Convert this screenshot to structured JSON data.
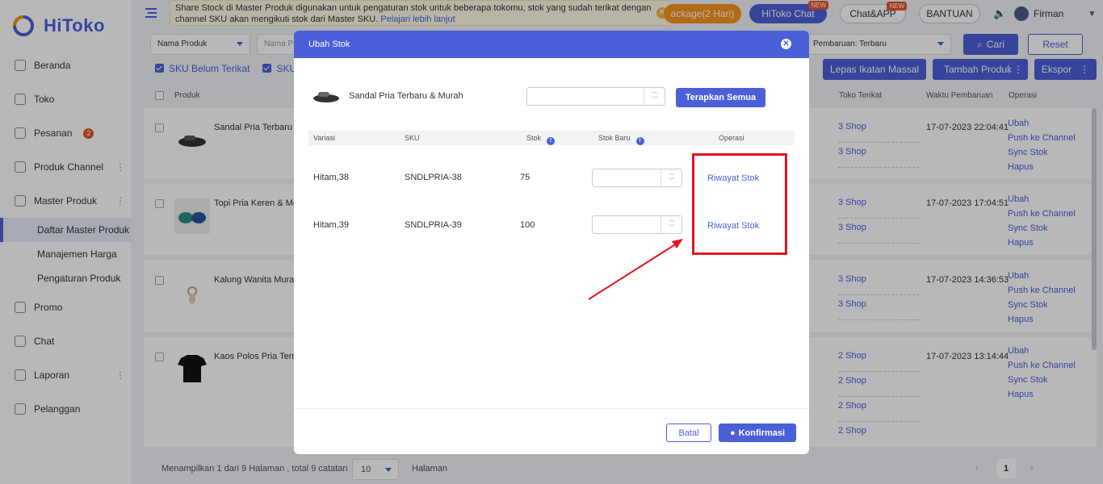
{
  "app": {
    "name": "HiToko"
  },
  "sidebar": {
    "items": [
      {
        "label": "Beranda"
      },
      {
        "label": "Toko"
      },
      {
        "label": "Pesanan",
        "badge": "2"
      },
      {
        "label": "Produk Channel"
      },
      {
        "label": "Master Produk"
      }
    ],
    "sub_items": [
      {
        "label": "Daftar Master Produk"
      },
      {
        "label": "Manajemen Harga"
      },
      {
        "label": "Pengaturan Produk"
      }
    ],
    "items_after": [
      {
        "label": "Promo"
      },
      {
        "label": "Chat"
      },
      {
        "label": "Laporan"
      },
      {
        "label": "Pelanggan"
      }
    ]
  },
  "topbar": {
    "notice": "Share Stock di Master Produk digunakan untuk pengaturan stok untuk beberapa tokomu, stok yang sudah terikat dengan channel SKU akan mengikuti stok dari Master SKU.",
    "notice_link": "Pelajari lebih lanjut",
    "package_label": "ackage(2 Hari)",
    "chat_label": "HiToko Chat",
    "chatapp_label": "Chat&APP",
    "new_tag": "NEW",
    "bantuan_label": "BANTUAN",
    "user_name": "Firman"
  },
  "filters": {
    "field_select": "Nama Produk",
    "field_input_placeholder": "Nama Pr",
    "sort_select": "Pembaruan: Terbaru",
    "search_label": "Cari",
    "reset_label": "Reset"
  },
  "checkbox_filters": [
    "SKU Belum Terikat",
    "SKU"
  ],
  "actions": {
    "lepas_label": "Lepas Ikatan Massal",
    "tambah_label": "Tambah Produk",
    "ekspor_label": "Ekspor"
  },
  "table": {
    "headers": {
      "produk": "Produk",
      "toko": "Toko Terikat",
      "waktu": "Waktu Pembaruan",
      "operasi": "Operasi"
    },
    "rows": [
      {
        "name": "Sandal Pria Terbaru &",
        "shops": [
          "3 Shop",
          "3 Shop"
        ],
        "time": "17-07-2023 22:04:41"
      },
      {
        "name": "Topi Pria Keren & Mo",
        "shops": [
          "3 Shop",
          "3 Shop"
        ],
        "time": "17-07-2023 17:04:51"
      },
      {
        "name": "Kalung Wanita Murah",
        "shops": [
          "3 Shop",
          "3 Shop"
        ],
        "time": "17-07-2023 14:36:53"
      },
      {
        "name": "Kaos Polos Pria Term",
        "shops": [
          "2 Shop",
          "2 Shop",
          "2 Shop",
          "2 Shop"
        ],
        "time": "17-07-2023 13:14:44"
      }
    ],
    "ops": [
      "Ubah",
      "Push ke Channel",
      "Sync Stok",
      "Hapus"
    ]
  },
  "footer": {
    "summary": "Menampilkan 1 dari 9 Halaman , total 9 catatan",
    "page_size": "10",
    "page_label": "Halaman",
    "current_page": "1"
  },
  "modal": {
    "title": "Ubah Stok",
    "product_name": "Sandal Pria Terbaru & Murah",
    "apply_all_label": "Terapkan Semua",
    "headers": {
      "variasi": "Variasi",
      "sku": "SKU",
      "stok": "Stok",
      "stok_baru": "Stok Baru",
      "operasi": "Operasi"
    },
    "rows": [
      {
        "variasi": "Hitam,38",
        "sku": "SNDLPRIA-38",
        "stok": "75",
        "op": "Riwayat Stok"
      },
      {
        "variasi": "Hitam,39",
        "sku": "SNDLPRIA-39",
        "stok": "100",
        "op": "Riwayat Stok"
      }
    ],
    "cancel_label": "Batal",
    "confirm_label": "Konfirmasi"
  },
  "colors": {
    "accent": "#4b5fd8",
    "annotation": "#e5131e",
    "warning": "#f7941d"
  }
}
